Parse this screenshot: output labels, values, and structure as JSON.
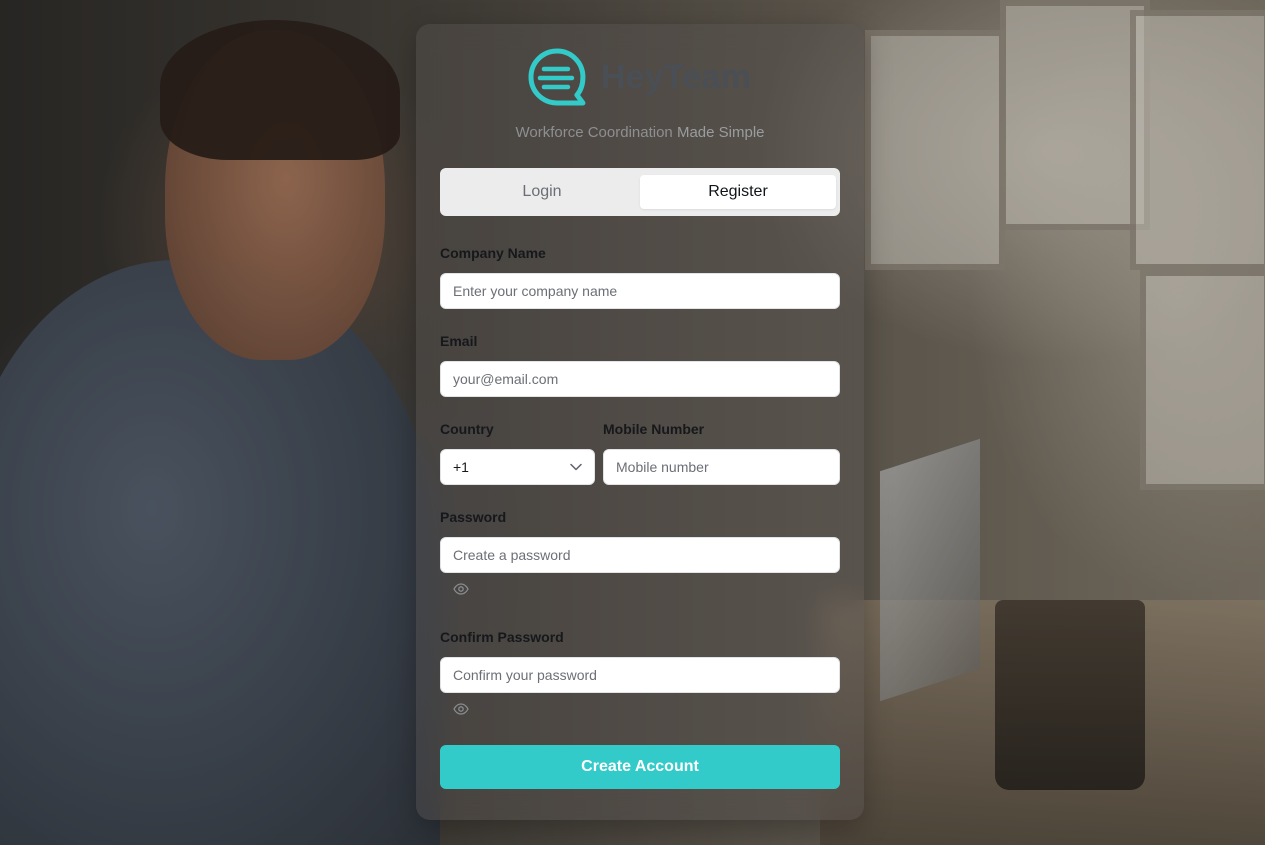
{
  "brand": {
    "name": "HeyTeam",
    "tagline_part1": "Workforce Coordination ",
    "tagline_part2": "Made Simple",
    "accent_color": "#33cbc9",
    "logo_icon": "chat-bubble-lines-icon"
  },
  "tabs": [
    {
      "label": "Login",
      "active": false
    },
    {
      "label": "Register",
      "active": true
    }
  ],
  "form": {
    "company": {
      "label": "Company Name",
      "placeholder": "Enter your company name",
      "value": ""
    },
    "email": {
      "label": "Email",
      "placeholder": "your@email.com",
      "value": ""
    },
    "country": {
      "label": "Country",
      "value": "+1",
      "icon": "chevron-down-icon"
    },
    "mobile": {
      "label": "Mobile Number",
      "placeholder": "Mobile number",
      "value": ""
    },
    "password": {
      "label": "Password",
      "placeholder": "Create a password",
      "value": "",
      "toggle_icon": "eye-icon"
    },
    "confirm_password": {
      "label": "Confirm Password",
      "placeholder": "Confirm your password",
      "value": "",
      "toggle_icon": "eye-icon"
    },
    "submit_label": "Create Account"
  }
}
